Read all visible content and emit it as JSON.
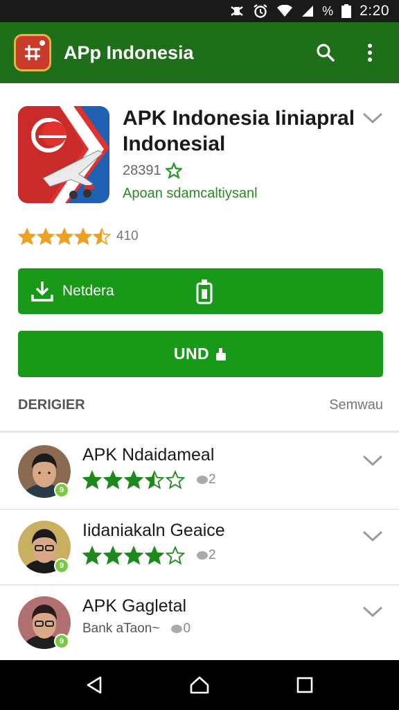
{
  "status_bar": {
    "time": "2:20",
    "battery_percent": "%"
  },
  "app_bar": {
    "title": "APp Indonesia",
    "search_icon": "search-icon",
    "menu_icon": "more-vert-icon"
  },
  "app": {
    "title": "APK Indonesia Iiniapral Indonesial",
    "count": "28391",
    "developer": "Apoan sdamcaltiysanl",
    "rating_stars": 4.5,
    "rating_count": "410"
  },
  "buttons": {
    "install_label": "Netdera",
    "open_label": "UND"
  },
  "section": {
    "title": "DERIGIER",
    "action": "Semwau"
  },
  "reviews": [
    {
      "name": "APK Ndaidameal",
      "stars": 3.5,
      "count": "2",
      "sub": ""
    },
    {
      "name": "Iidaniakaln Geaice",
      "stars": 4,
      "count": "2",
      "sub": ""
    },
    {
      "name": "APK Gagletal",
      "stars": 0,
      "count": "0",
      "sub": "Bank aTaon~"
    }
  ],
  "colors": {
    "app_bar": "#1f6e1a",
    "button": "#189a18",
    "star_review": "#1e8a1e",
    "star_hero": "#f0a020",
    "link": "#2a8a22"
  }
}
